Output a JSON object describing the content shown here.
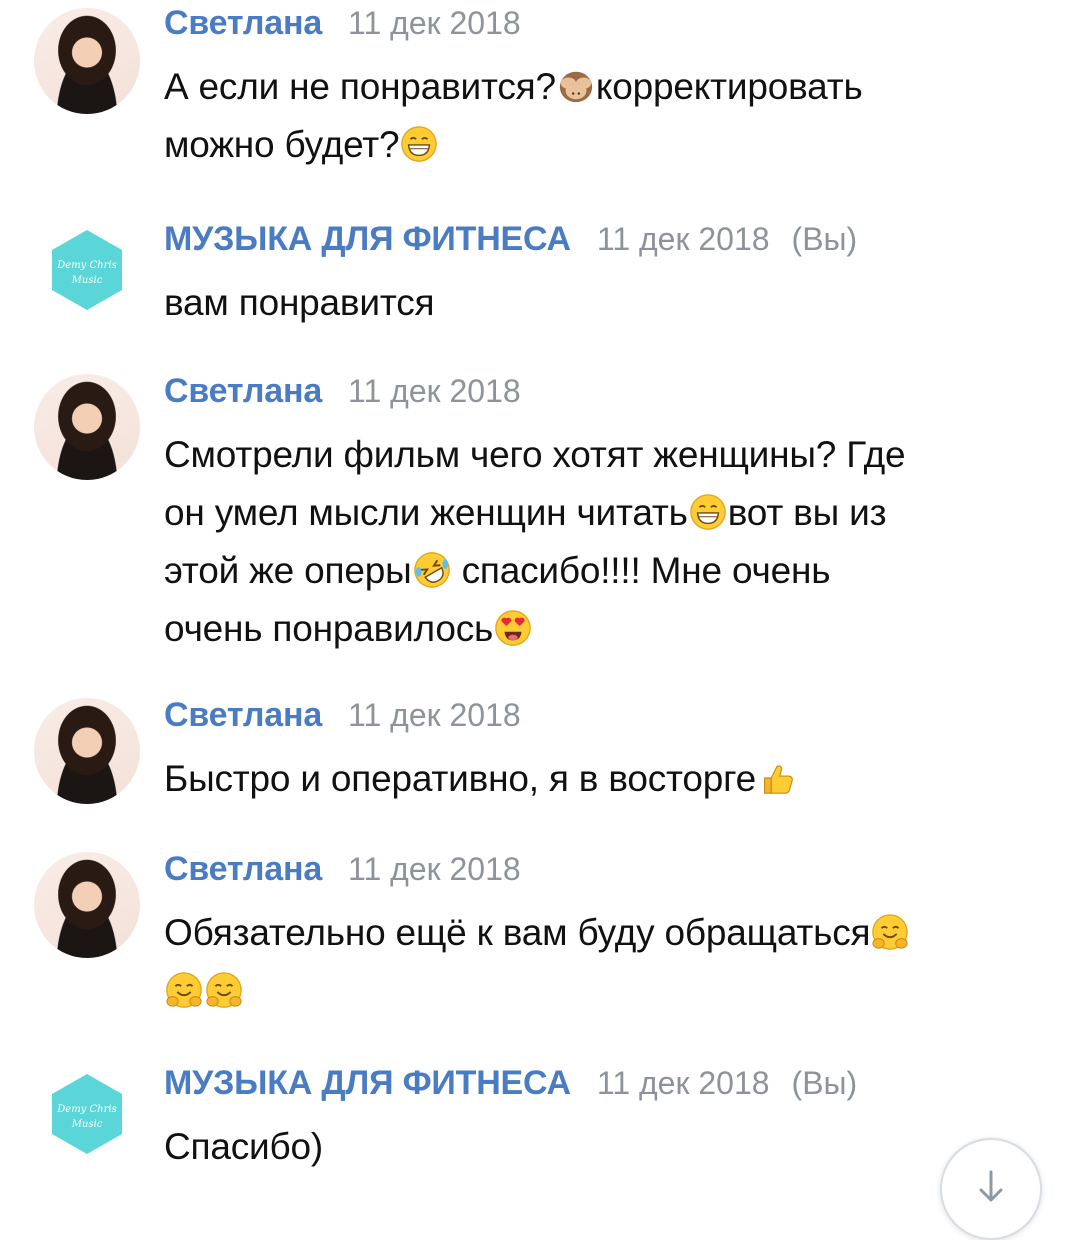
{
  "messages": [
    {
      "author": "Светлана",
      "date": "11 дек 2018",
      "lines": [
        {
          "parts": [
            "А если не понравится?",
            "корректировать"
          ]
        },
        {
          "parts": [
            "можно будет?",
            ""
          ]
        }
      ]
    },
    {
      "author": "МУЗЫКА ДЛЯ ФИТНЕСА",
      "date": "11 дек 2018",
      "you": "(Вы)",
      "text": "вам понравится"
    },
    {
      "author": "Светлана",
      "date": "11 дек 2018",
      "lines": [
        {
          "parts": [
            "Смотрели фильм чего хотят женщины? Где"
          ]
        },
        {
          "parts": [
            "он умел мысли женщин читать",
            "вот вы из"
          ]
        },
        {
          "parts": [
            "этой же оперы",
            " спасибо!!!! Мне очень"
          ]
        },
        {
          "parts": [
            "очень понравилось",
            ""
          ]
        }
      ]
    },
    {
      "author": "Светлана",
      "date": "11 дек 2018",
      "lines": [
        {
          "parts": [
            "Быстро и оперативно, я в восторге",
            ""
          ]
        }
      ]
    },
    {
      "author": "Светлана",
      "date": "11 дек 2018",
      "lines": [
        {
          "parts": [
            "Обязательно ещё к вам буду обращаться",
            ""
          ]
        }
      ]
    },
    {
      "author": "МУЗЫКА ДЛЯ ФИТНЕСА",
      "date": "11 дек 2018",
      "you": "(Вы)",
      "text": "Спасибо)"
    }
  ],
  "brand_avatar_text": [
    "Demy Chris",
    "Music"
  ],
  "colors": {
    "author_name": "#4a7cc3",
    "date": "#8d939a",
    "brand_avatar": "#5bd6d8"
  },
  "icons": {
    "scroll_down": "arrow-down-icon",
    "emoji_see_no_evil": "see-no-evil-monkey-icon",
    "emoji_grin": "grinning-face-icon",
    "emoji_rofl": "rofl-face-icon",
    "emoji_heart_eyes": "heart-eyes-face-icon",
    "emoji_thumbs_up": "thumbs-up-icon",
    "emoji_hug": "hugging-face-icon"
  }
}
